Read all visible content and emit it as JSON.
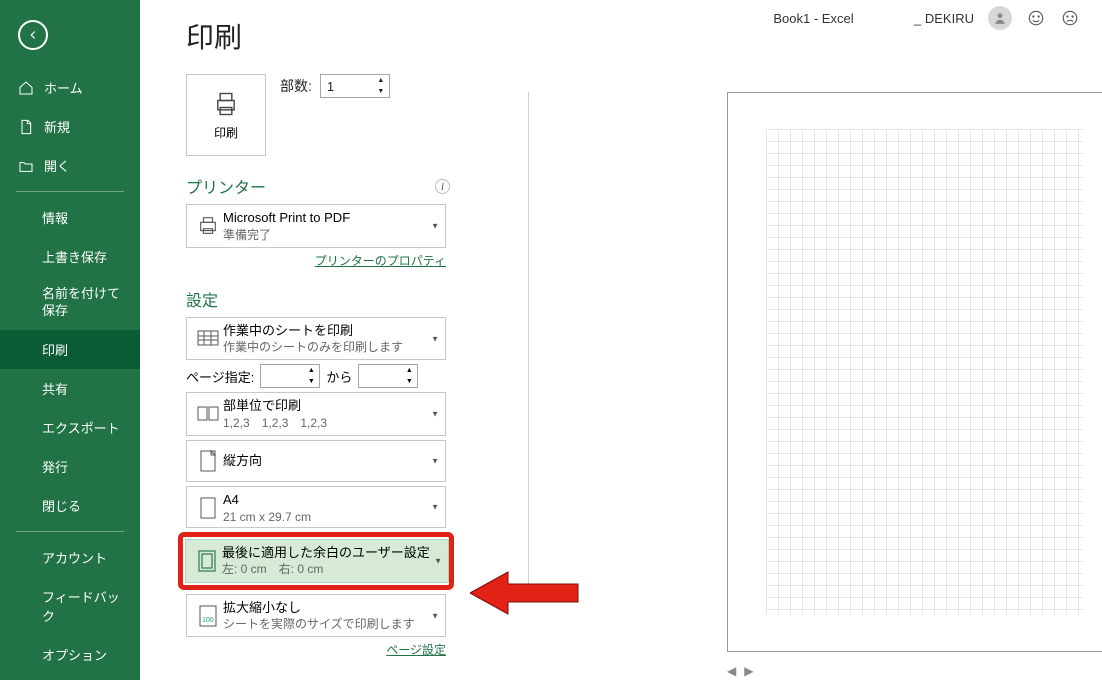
{
  "title_bar": {
    "doc": "Book1  -  Excel",
    "user": "_ DEKIRU"
  },
  "sidebar": {
    "home": "ホーム",
    "new": "新規",
    "open": "開く",
    "info": "情報",
    "save": "上書き保存",
    "saveas": "名前を付けて保存",
    "print": "印刷",
    "share": "共有",
    "export": "エクスポート",
    "publish": "発行",
    "close": "閉じる",
    "account": "アカウント",
    "feedback": "フィードバック",
    "options": "オプション"
  },
  "print": {
    "title": "印刷",
    "button_label": "印刷",
    "copies_label": "部数:",
    "copies_value": "1"
  },
  "printer": {
    "heading": "プリンター",
    "name": "Microsoft Print to PDF",
    "status": "準備完了",
    "props_link": "プリンターのプロパティ"
  },
  "settings": {
    "heading": "設定",
    "what": {
      "title": "作業中のシートを印刷",
      "sub": "作業中のシートのみを印刷します"
    },
    "page_range_label": "ページ指定:",
    "page_range_to": "から",
    "collate": {
      "title": "部単位で印刷",
      "sub": "1,2,3　1,2,3　1,2,3"
    },
    "orientation": {
      "title": "縦方向"
    },
    "paper": {
      "title": "A4",
      "sub": "21 cm x 29.7 cm"
    },
    "margins": {
      "title": "最後に適用した余白のユーザー設定",
      "sub": "左:  0 cm　右:  0 cm"
    },
    "scaling": {
      "title": "拡大縮小なし",
      "sub": "シートを実際のサイズで印刷します"
    },
    "page_setup_link": "ページ設定"
  },
  "icons": {
    "printer": "printer",
    "sheet": "sheet",
    "pages": "pages",
    "orientation": "orientation",
    "pagesize": "pagesize",
    "margins": "margins",
    "scale": "scale"
  }
}
